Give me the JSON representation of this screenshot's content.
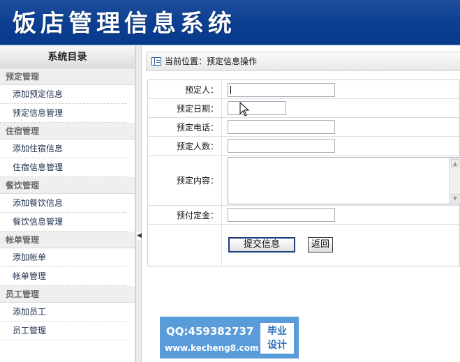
{
  "header": {
    "title": "饭店管理信息系统"
  },
  "sidebar": {
    "title": "系统目录",
    "groups": [
      {
        "label": "预定管理",
        "items": [
          "添加预定信息",
          "预定信息管理"
        ]
      },
      {
        "label": "住宿管理",
        "items": [
          "添加住宿信息",
          "住宿信息管理"
        ]
      },
      {
        "label": "餐饮管理",
        "items": [
          "添加餐饮信息",
          "餐饮信息管理"
        ]
      },
      {
        "label": "帐单管理",
        "items": [
          "添加帐单",
          "帐单管理"
        ]
      },
      {
        "label": "员工管理",
        "items": [
          "添加员工",
          "员工管理"
        ]
      }
    ]
  },
  "breadcrumb": {
    "text": "当前位置：预定信息操作"
  },
  "form": {
    "fields": {
      "reserver": {
        "label": "预定人：",
        "value": ""
      },
      "date": {
        "label": "预定日期：",
        "value": ""
      },
      "phone": {
        "label": "预定电话：",
        "value": ""
      },
      "count": {
        "label": "预定人数：",
        "value": ""
      },
      "content": {
        "label": "预定内容：",
        "value": ""
      },
      "deposit": {
        "label": "预付定金：",
        "value": ""
      }
    },
    "submit_label": "提交信息",
    "back_label": "返回"
  },
  "watermark": {
    "qq": "QQ:459382737",
    "url": "www.kecheng8.com",
    "badge_line1": "毕业",
    "badge_line2": "设计"
  }
}
